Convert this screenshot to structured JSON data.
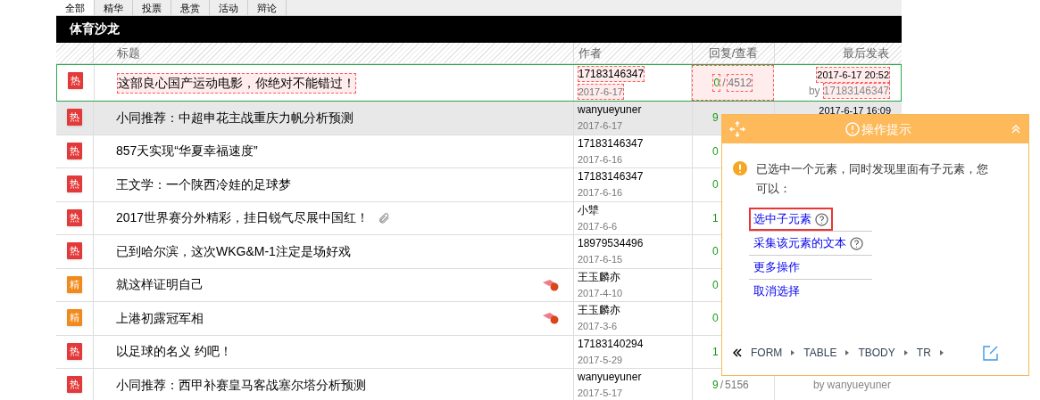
{
  "tabs": [
    {
      "label": "全部",
      "selected": true
    },
    {
      "label": "精华",
      "selected": false
    },
    {
      "label": "投票",
      "selected": false
    },
    {
      "label": "悬赏",
      "selected": false
    },
    {
      "label": "活动",
      "selected": false
    },
    {
      "label": "辩论",
      "selected": false
    }
  ],
  "forum": {
    "title": "体育沙龙"
  },
  "table": {
    "columns": [
      "标题",
      "作者",
      "回复/查看",
      "最后发表"
    ],
    "rows": [
      {
        "kind": "hot",
        "badge": "热",
        "title": "这部良心国产运动电影，你绝对不能错过！",
        "attachment": false,
        "reward": false,
        "author": "17183146347",
        "date": "2017-6-17",
        "replies": "0",
        "separator": "/",
        "views": "4512",
        "last_time": "2017-6-17 20:52",
        "by": "by",
        "last_user": "17183146347",
        "selected": true,
        "hovered": false
      },
      {
        "kind": "hot",
        "badge": "热",
        "title": "小同推荐：中超申花主战重庆力帆分析预测",
        "attachment": false,
        "reward": false,
        "author": "wanyueyuner",
        "date": "2017-6-17",
        "replies": "9",
        "views": "",
        "last_time": "2017-6-17 16:09",
        "by": "",
        "last_user": "",
        "selected": false,
        "hovered": true
      },
      {
        "kind": "hot",
        "badge": "热",
        "title": "857天实现“华夏幸福速度”",
        "attachment": false,
        "reward": false,
        "author": "17183146347",
        "date": "2017-6-16",
        "replies": "0",
        "views": "",
        "last_time": "",
        "by": "",
        "last_user": "",
        "selected": false,
        "hovered": false
      },
      {
        "kind": "hot",
        "badge": "热",
        "title": "王文学：一个陕西冷娃的足球梦",
        "attachment": false,
        "reward": false,
        "author": "17183146347",
        "date": "2017-6-16",
        "replies": "0",
        "views": "",
        "last_time": "",
        "by": "",
        "last_user": "",
        "selected": false,
        "hovered": false
      },
      {
        "kind": "hot",
        "badge": "热",
        "title": "2017世界赛分外精彩，挂日锐气尽展中国红！",
        "attachment": true,
        "reward": false,
        "author": "小犨",
        "date": "2017-6-6",
        "replies": "1",
        "views": "",
        "last_time": "",
        "by": "",
        "last_user": "",
        "selected": false,
        "hovered": false
      },
      {
        "kind": "hot",
        "badge": "热",
        "title": "已到哈尔滨，这次WKG&M-1注定是场好戏",
        "attachment": false,
        "reward": false,
        "author": "18979534496",
        "date": "2017-6-15",
        "replies": "0",
        "views": "",
        "last_time": "",
        "by": "",
        "last_user": "",
        "selected": false,
        "hovered": false
      },
      {
        "kind": "digest",
        "badge": "精",
        "title": "就这样证明自己",
        "attachment": false,
        "reward": true,
        "author": "王玉麟亦",
        "date": "2017-4-10",
        "replies": "0",
        "views": "",
        "last_time": "",
        "by": "",
        "last_user": "",
        "selected": false,
        "hovered": false
      },
      {
        "kind": "digest",
        "badge": "精",
        "title": "上港初露冠军相",
        "attachment": false,
        "reward": true,
        "author": "王玉麟亦",
        "date": "2017-3-6",
        "replies": "0",
        "views": "",
        "last_time": "",
        "by": "",
        "last_user": "",
        "selected": false,
        "hovered": false
      },
      {
        "kind": "hot",
        "badge": "热",
        "title": "以足球的名义 约吧！",
        "attachment": false,
        "reward": false,
        "author": "17183140294",
        "date": "2017-5-29",
        "replies": "1",
        "views": "",
        "last_time": "",
        "by": "",
        "last_user": "",
        "selected": false,
        "hovered": false
      },
      {
        "kind": "hot",
        "badge": "热",
        "title": "小同推荐：西甲补赛皇马客战塞尔塔分析预测",
        "attachment": false,
        "reward": false,
        "author": "wanyueyuner",
        "date": "2017-5-17",
        "replies": "9",
        "separator": "/",
        "views": "5156",
        "last_time": "",
        "by": "by",
        "last_user": "wanyueyuner",
        "selected": false,
        "hovered": false
      }
    ]
  },
  "panel": {
    "title": "操作提示",
    "message": "已选中一个元素，同时发现里面有子元素，您可以：",
    "actions": [
      {
        "label": "选中子元素",
        "help": true,
        "selected": true
      },
      {
        "label": "采集该元素的文本",
        "help": true,
        "selected": false
      },
      {
        "label": "更多操作",
        "help": false,
        "selected": false
      },
      {
        "label": "取消选择",
        "help": false,
        "selected": false
      }
    ],
    "breadcrumb": [
      "FORM",
      "TABLE",
      "TBODY",
      "TR"
    ]
  }
}
